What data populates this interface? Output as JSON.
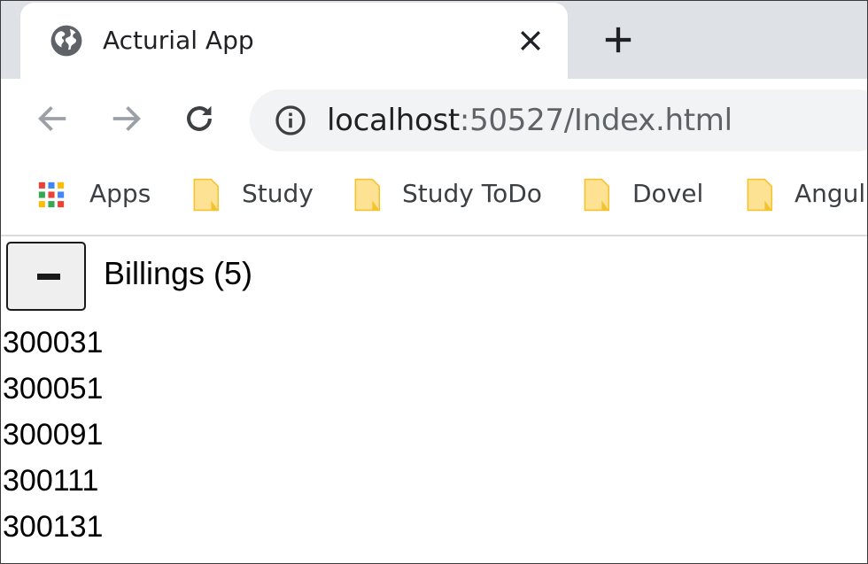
{
  "browser": {
    "tab": {
      "title": "Acturial App",
      "icon": "globe-icon"
    },
    "address": {
      "host": "localhost",
      "rest": ":50527/Index.html"
    },
    "bookmarks": [
      {
        "label": "Apps",
        "icon": "apps-grid-icon"
      },
      {
        "label": "Study",
        "icon": "folder-icon"
      },
      {
        "label": "Study ToDo",
        "icon": "folder-icon"
      },
      {
        "label": "Dovel",
        "icon": "folder-icon"
      },
      {
        "label": "Angul",
        "icon": "folder-icon"
      }
    ],
    "colors": {
      "tabstrip": "#dee1e6",
      "omnibox": "#f1f3f4",
      "folder": "#fde293",
      "nav_disabled": "#9aa0a6"
    }
  },
  "page": {
    "toggle": {
      "symbol": "minus-icon"
    },
    "billings_title": "Billings (5)",
    "billings": [
      "300031",
      "300051",
      "300091",
      "300111",
      "300131"
    ]
  }
}
